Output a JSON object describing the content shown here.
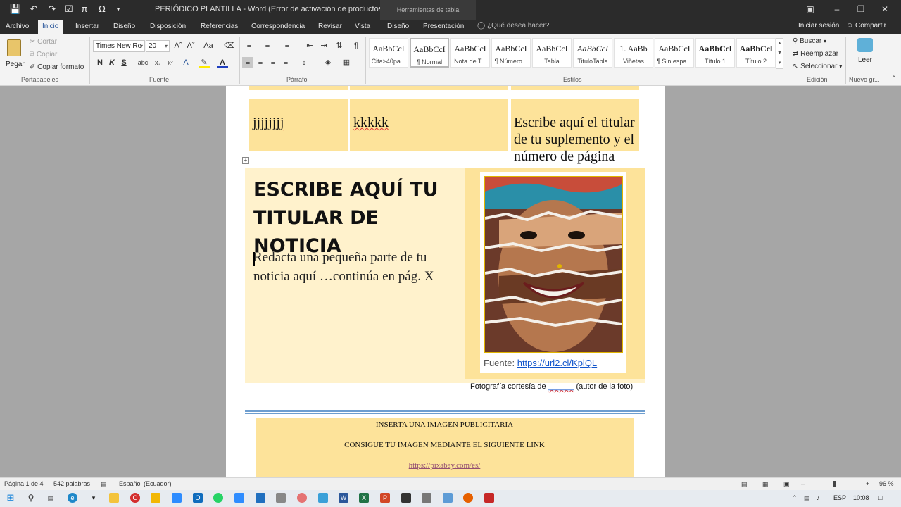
{
  "titlebar": {
    "title": "PERIÓDICO PLANTILLA - Word (Error de activación de productos)",
    "contextual_tab": "Herramientas de tabla",
    "qa_icons": [
      "save-icon",
      "undo-icon",
      "redo-icon",
      "checkbox-icon",
      "pi-icon",
      "omega-icon",
      "customize-icon"
    ]
  },
  "tabs": [
    "Archivo",
    "Inicio",
    "Insertar",
    "Diseño",
    "Disposición",
    "Referencias",
    "Correspondencia",
    "Revisar",
    "Vista",
    "Diseño",
    "Presentación"
  ],
  "active_tab": "Inicio",
  "tellme_placeholder": "¿Qué desea hacer?",
  "signin": "Iniciar sesión",
  "share": "Compartir",
  "ribbon": {
    "clipboard": {
      "paste": "Pegar",
      "cut": "Cortar",
      "copy": "Copiar",
      "format_painter": "Copiar formato",
      "label": "Portapapeles"
    },
    "font": {
      "family": "Times New Ro",
      "size": "20",
      "label": "Fuente",
      "bold": "N",
      "italic": "K",
      "underline": "S",
      "strike": "abc",
      "sub": "x₂",
      "sup": "x²"
    },
    "paragraph": {
      "label": "Párrafo"
    },
    "styles": {
      "label": "Estilos",
      "items": [
        {
          "sample": "AaBbCcI",
          "name": "Cita>40pa..."
        },
        {
          "sample": "AaBbCcI",
          "name": "¶ Normal"
        },
        {
          "sample": "AaBbCcI",
          "name": "Nota de T..."
        },
        {
          "sample": "AaBbCcI",
          "name": "¶ Número..."
        },
        {
          "sample": "AaBbCcI",
          "name": "Tabla"
        },
        {
          "sample": "AaBbCcI",
          "name": "TituloTabla"
        },
        {
          "sample": "1. AaBb",
          "name": "Viñetas"
        },
        {
          "sample": "AaBbCcI",
          "name": "¶ Sin espa..."
        },
        {
          "sample": "AaBbCcl",
          "name": "Título 1"
        },
        {
          "sample": "AaBbCcl",
          "name": "Título 2"
        }
      ]
    },
    "editing": {
      "find": "Buscar",
      "replace": "Reemplazar",
      "select": "Seleccionar",
      "label": "Edición"
    },
    "read": {
      "read": "Leer",
      "label": "Nuevo gr..."
    }
  },
  "document": {
    "table_row": [
      {
        "text": "jjjjjjjj"
      },
      {
        "text": "kkkkk"
      },
      {
        "text": "Escribe aquí el titular de tu suplemento y el número de página"
      }
    ],
    "headline": "ESCRIBE AQUÍ TU TITULAR DE NOTICIA",
    "lead": "Redacta una pequeña parte de tu noticia aquí …continúa en pág. X",
    "photo_source_label": "Fuente:",
    "photo_source_url": "https://url2.cl/KplQL",
    "caption_prefix": "Fotografía cortesía de",
    "caption_blank": "______",
    "caption_suffix": "(autor de la foto)",
    "ad_line1": "INSERTA UNA IMAGEN PUBLICITARIA",
    "ad_line2": "CONSIGUE TU IMAGEN MEDIANTE EL SIGUIENTE LINK",
    "ad_link": "https://pixabay.com/es/"
  },
  "status": {
    "page": "Página 1 de 4",
    "words": "542 palabras",
    "language": "Español (Ecuador)",
    "zoom": "96 %"
  },
  "taskbar": {
    "lang": "ESP",
    "time": "10:08"
  }
}
